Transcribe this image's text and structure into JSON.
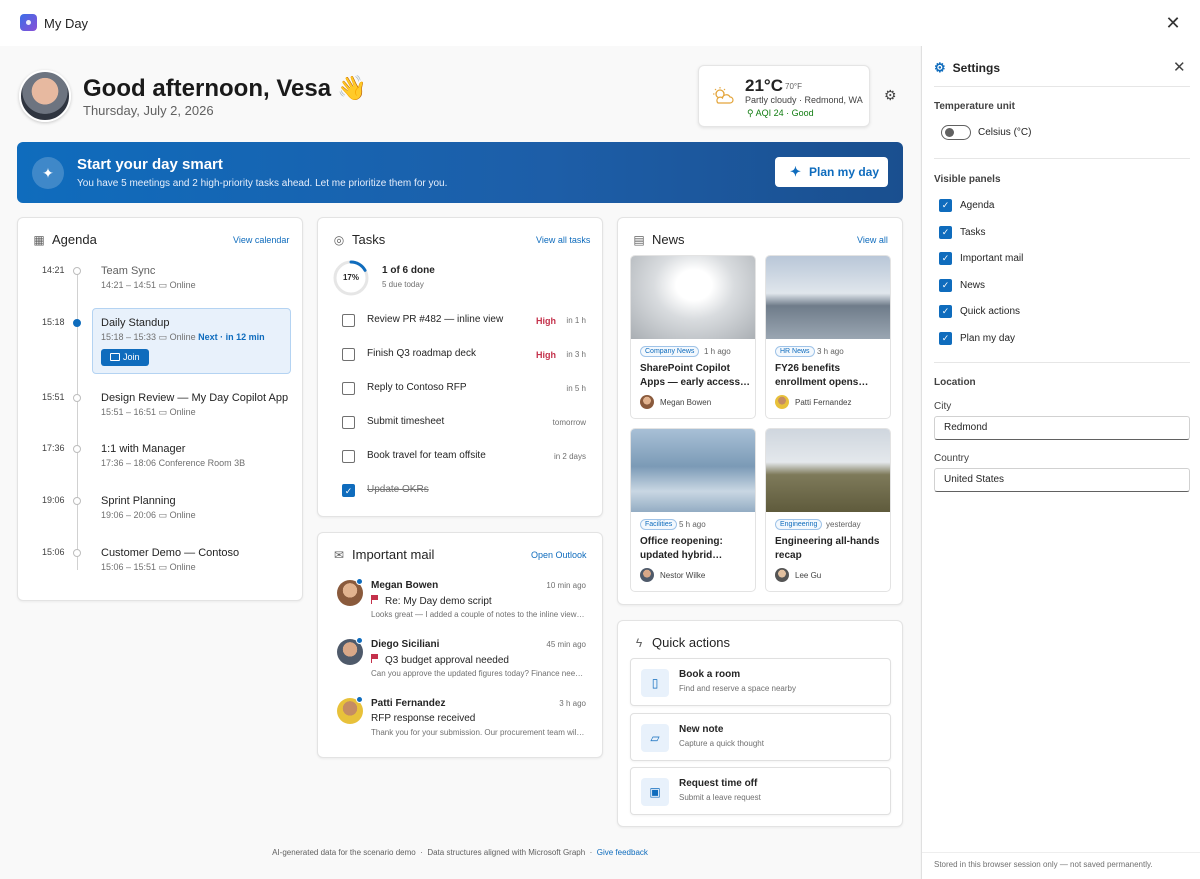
{
  "window": {
    "title": "My Day",
    "close_icon": "close-icon"
  },
  "header": {
    "greeting": "Good afternoon, Vesa",
    "wave": "👋",
    "date": "Thursday, July 2, 2026"
  },
  "weather": {
    "temp": "21°C",
    "temp_f": "70°F",
    "condition": "Partly cloudy · Redmond, WA",
    "aqi": "AQI 24 · Good",
    "icon": "partly-cloudy-icon"
  },
  "banner": {
    "title": "Start your day smart",
    "subtitle": "You have 5 meetings and 2 high-priority tasks ahead. Let me prioritize them for you.",
    "button": "Plan my day",
    "colors": {
      "start": "#0f6cbd",
      "end": "#1a4f8f"
    }
  },
  "agenda": {
    "title": "Agenda",
    "link": "View calendar",
    "items": [
      {
        "time": "14:21",
        "title": "Team Sync",
        "range": "14:21 – 14:51",
        "location": "Online",
        "state": "past"
      },
      {
        "time": "15:18",
        "title": "Daily Standup",
        "range": "15:18 – 15:33",
        "location": "Online",
        "next": "Next · in 12 min",
        "state": "now",
        "join": "Join"
      },
      {
        "time": "15:51",
        "title": "Design Review — My Day Copilot App",
        "range": "15:51 – 16:51",
        "location": "Online"
      },
      {
        "time": "17:36",
        "title": "1:1 with Manager",
        "range": "17:36 – 18:06",
        "location": "Conference Room 3B"
      },
      {
        "time": "19:06",
        "title": "Sprint Planning",
        "range": "19:06 – 20:06",
        "location": "Online"
      },
      {
        "time": "15:06",
        "title": "Customer Demo — Contoso",
        "range": "15:06 – 15:51",
        "location": "Online"
      }
    ]
  },
  "tasks": {
    "title": "Tasks",
    "link": "View all tasks",
    "progress_pct": "17%",
    "progress_value": 0.17,
    "done": "1 of 6 done",
    "due_today": "5 due today",
    "items": [
      {
        "label": "Review PR #482 — inline view",
        "priority": "High",
        "due": "in 1 h",
        "done": false
      },
      {
        "label": "Finish Q3 roadmap deck",
        "priority": "High",
        "due": "in 3 h",
        "done": false
      },
      {
        "label": "Reply to Contoso RFP",
        "priority": "",
        "due": "in 5 h",
        "done": false
      },
      {
        "label": "Submit timesheet",
        "priority": "",
        "due": "tomorrow",
        "done": false
      },
      {
        "label": "Book travel for team offsite",
        "priority": "",
        "due": "in 2 days",
        "done": false
      },
      {
        "label": "Update OKRs",
        "priority": "",
        "due": "",
        "done": true
      }
    ]
  },
  "mail": {
    "title": "Important mail",
    "link": "Open Outlook",
    "items": [
      {
        "from": "Megan Bowen",
        "time": "10 min ago",
        "subject": "Re: My Day demo script",
        "flag": true,
        "preview": "Looks great — I added a couple of notes to the inline view section."
      },
      {
        "from": "Diego Siciliani",
        "time": "45 min ago",
        "subject": "Q3 budget approval needed",
        "flag": true,
        "preview": "Can you approve the updated figures today? Finance needs them."
      },
      {
        "from": "Patti Fernandez",
        "time": "3 h ago",
        "subject": "RFP response received",
        "flag": false,
        "preview": "Thank you for your submission. Our procurement team will review."
      }
    ]
  },
  "news": {
    "title": "News",
    "link": "View all",
    "items": [
      {
        "tag": "Company News",
        "ago": "1 h ago",
        "line1": "SharePoint Copilot",
        "line2": "Apps — early access…",
        "author": "Megan Bowen"
      },
      {
        "tag": "HR News",
        "ago": "3 h ago",
        "line1": "FY26 benefits",
        "line2": "enrollment opens…",
        "author": "Patti Fernandez"
      },
      {
        "tag": "Facilities",
        "ago": "5 h ago",
        "line1": "Office reopening:",
        "line2": "updated hybrid…",
        "author": "Nestor Wilke"
      },
      {
        "tag": "Engineering",
        "ago": "yesterday",
        "line1": "Engineering all-hands",
        "line2": "recap",
        "author": "Lee Gu"
      }
    ]
  },
  "quick_actions": {
    "title": "Quick actions",
    "items": [
      {
        "title": "Book a room",
        "sub": "Find and reserve a space nearby",
        "icon": "door-icon"
      },
      {
        "title": "New note",
        "sub": "Capture a quick thought",
        "icon": "note-icon"
      },
      {
        "title": "Request time off",
        "sub": "Submit a leave request",
        "icon": "calendar-person-icon"
      }
    ]
  },
  "footer": {
    "text1": "AI-generated data for the scenario demo",
    "sep": "·",
    "text2": "Data structures aligned with Microsoft Graph",
    "link": "Give feedback"
  },
  "settings": {
    "title": "Settings",
    "temp_unit_label": "Temperature unit",
    "temp_toggle": "Celsius (°C)",
    "panels_label": "Visible panels",
    "panels": [
      "Agenda",
      "Tasks",
      "Important mail",
      "News",
      "Quick actions",
      "Plan my day"
    ],
    "location_label": "Location",
    "city_label": "City",
    "city_value": "Redmond",
    "country_label": "Country",
    "country_value": "United States",
    "footnote": "Stored in this browser session only — not saved permanently."
  }
}
